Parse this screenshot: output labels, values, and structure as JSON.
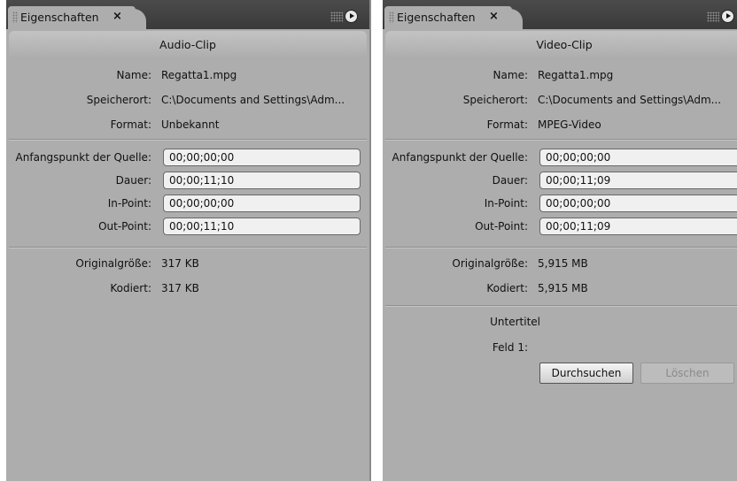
{
  "left": {
    "tab_label": "Eigenschaften",
    "tab_close": "×",
    "header": "Audio-Clip",
    "info": [
      {
        "label": "Name:",
        "value": "Regatta1.mpg"
      },
      {
        "label": "Speicherort:",
        "value": "C:\\Documents and Settings\\Adm..."
      },
      {
        "label": "Format:",
        "value": "Unbekannt"
      }
    ],
    "fields": [
      {
        "label": "Anfangspunkt der Quelle:",
        "value": "00;00;00;00"
      },
      {
        "label": "Dauer:",
        "value": "00;00;11;10"
      },
      {
        "label": "In-Point:",
        "value": "00;00;00;00"
      },
      {
        "label": "Out-Point:",
        "value": "00;00;11;10"
      }
    ],
    "sizes": [
      {
        "label": "Originalgröße:",
        "value": "317 KB"
      },
      {
        "label": "Kodiert:",
        "value": "317 KB"
      }
    ]
  },
  "right": {
    "tab_label": "Eigenschaften",
    "tab_close": "×",
    "header": "Video-Clip",
    "info": [
      {
        "label": "Name:",
        "value": "Regatta1.mpg"
      },
      {
        "label": "Speicherort:",
        "value": "C:\\Documents and Settings\\Adm..."
      },
      {
        "label": "Format:",
        "value": "MPEG-Video"
      }
    ],
    "fields": [
      {
        "label": "Anfangspunkt der Quelle:",
        "value": "00;00;00;00"
      },
      {
        "label": "Dauer:",
        "value": "00;00;11;09"
      },
      {
        "label": "In-Point:",
        "value": "00;00;00;00"
      },
      {
        "label": "Out-Point:",
        "value": "00;00;11;09"
      }
    ],
    "sizes": [
      {
        "label": "Originalgröße:",
        "value": "5,915 MB"
      },
      {
        "label": "Kodiert:",
        "value": "5,915 MB"
      }
    ],
    "subtitles": {
      "title": "Untertitel",
      "field_label": "Feld 1:",
      "browse_button": "Durchsuchen",
      "delete_button": "Löschen"
    }
  }
}
